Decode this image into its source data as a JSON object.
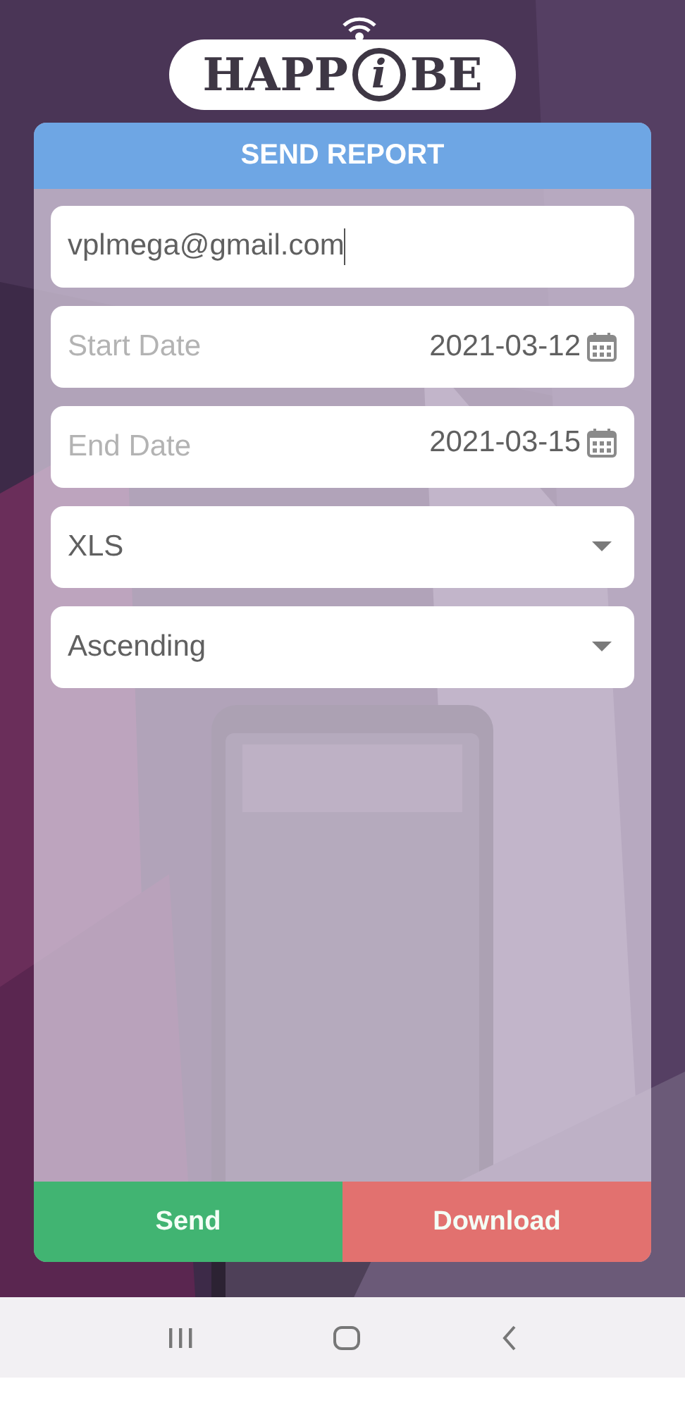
{
  "logo": {
    "parts": [
      "HAPP",
      "i",
      "BE"
    ]
  },
  "card": {
    "title": "SEND REPORT",
    "fields": [
      {
        "kind": "text",
        "value": "vplmega@gmail.com",
        "focused": true
      },
      {
        "kind": "date",
        "placeholder": "Start Date",
        "value": "2021-03-12"
      },
      {
        "kind": "date",
        "placeholder": "End Date",
        "value": "2021-03-15"
      },
      {
        "kind": "select",
        "value": "XLS"
      },
      {
        "kind": "select",
        "value": "Ascending"
      }
    ],
    "buttons": [
      {
        "label": "Send",
        "color": "#41b472"
      },
      {
        "label": "Download",
        "color": "#e2716f"
      }
    ]
  }
}
